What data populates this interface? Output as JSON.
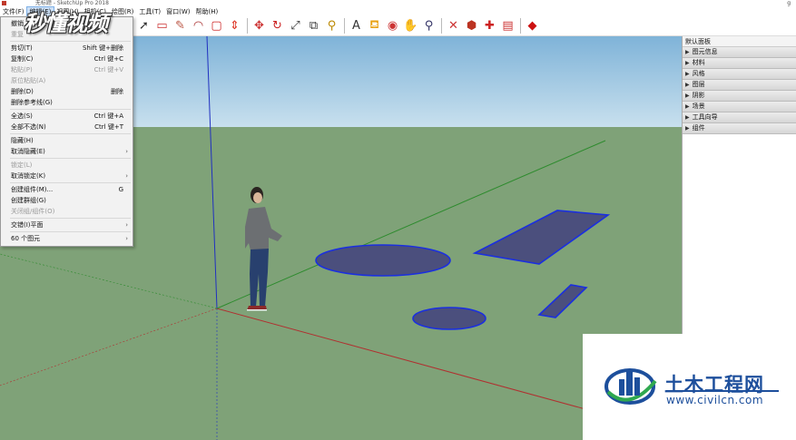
{
  "app": {
    "title": "无标题 - SketchUp Pro 2018"
  },
  "menubar": {
    "items": [
      "文件(F)",
      "编辑(E)",
      "视图(V)",
      "相机(C)",
      "绘图(R)",
      "工具(T)",
      "窗口(W)",
      "帮助(H)"
    ],
    "active_index": 1
  },
  "toolbar": {
    "icons": [
      "select-icon",
      "eraser-icon",
      "pencil-icon",
      "arc-icon",
      "shapes-icon",
      "push-pull-icon",
      "move-icon",
      "rotate-icon",
      "scale-icon",
      "offset-icon",
      "tape-measure-icon",
      "text-icon",
      "paint-bucket-icon",
      "orbit-icon",
      "pan-icon",
      "zoom-icon",
      "zoom-extents-icon",
      "warehouse-icon",
      "extension-warehouse-icon",
      "layout-icon",
      "ruby-icon"
    ]
  },
  "edit_menu": {
    "items": [
      {
        "label": "撤销 ",
        "shortcut": "",
        "disabled": false
      },
      {
        "label": "重复",
        "shortcut": "",
        "disabled": true
      },
      {
        "sep": true
      },
      {
        "label": "剪切(T)",
        "shortcut": "Shift 键+删除",
        "disabled": false
      },
      {
        "label": "复制(C)",
        "shortcut": "Ctrl 键+C",
        "disabled": false
      },
      {
        "label": "粘贴(P)",
        "shortcut": "Ctrl 键+V",
        "disabled": true
      },
      {
        "label": "原位粘贴(A)",
        "shortcut": "",
        "disabled": true
      },
      {
        "label": "删除(D)",
        "shortcut": "删除",
        "disabled": false
      },
      {
        "label": "删除参考线(G)",
        "shortcut": "",
        "disabled": false
      },
      {
        "sep": true
      },
      {
        "label": "全选(S)",
        "shortcut": "Ctrl 键+A",
        "disabled": false
      },
      {
        "label": "全部不选(N)",
        "shortcut": "Ctrl 键+T",
        "disabled": false
      },
      {
        "sep": true
      },
      {
        "label": "隐藏(H)",
        "shortcut": "",
        "disabled": false
      },
      {
        "label": "取消隐藏(E)",
        "shortcut": "",
        "disabled": false,
        "submenu": true
      },
      {
        "sep": true
      },
      {
        "label": "锁定(L)",
        "shortcut": "",
        "disabled": true
      },
      {
        "label": "取消锁定(K)",
        "shortcut": "",
        "disabled": false,
        "submenu": true
      },
      {
        "sep": true
      },
      {
        "label": "创建组件(M)...",
        "shortcut": "G",
        "disabled": false
      },
      {
        "label": "创建群组(G)",
        "shortcut": "",
        "disabled": false
      },
      {
        "label": "关闭组/组件(O)",
        "shortcut": "",
        "disabled": true
      },
      {
        "sep": true
      },
      {
        "label": "交错(I)平面",
        "shortcut": "",
        "disabled": false,
        "submenu": true
      },
      {
        "sep": true
      },
      {
        "label": "60 个图元",
        "shortcut": "",
        "disabled": false,
        "submenu": true
      }
    ]
  },
  "tray": {
    "title": "默认面板",
    "items": [
      "图元信息",
      "材料",
      "风格",
      "图层",
      "阴影",
      "场景",
      "工具向导",
      "组件"
    ]
  },
  "watermark_top": "秒懂视频",
  "watermark_site": {
    "name": "土木工程网",
    "url": "www.civilcn.com"
  },
  "colors": {
    "sky": "#aed0e6",
    "ground": "#7fa278",
    "selection_fill": "#4b4f7d",
    "selection_edge": "#1a2fe0",
    "axis_red": "#b03030",
    "axis_green": "#2e8b2e",
    "axis_blue": "#2030c0"
  }
}
